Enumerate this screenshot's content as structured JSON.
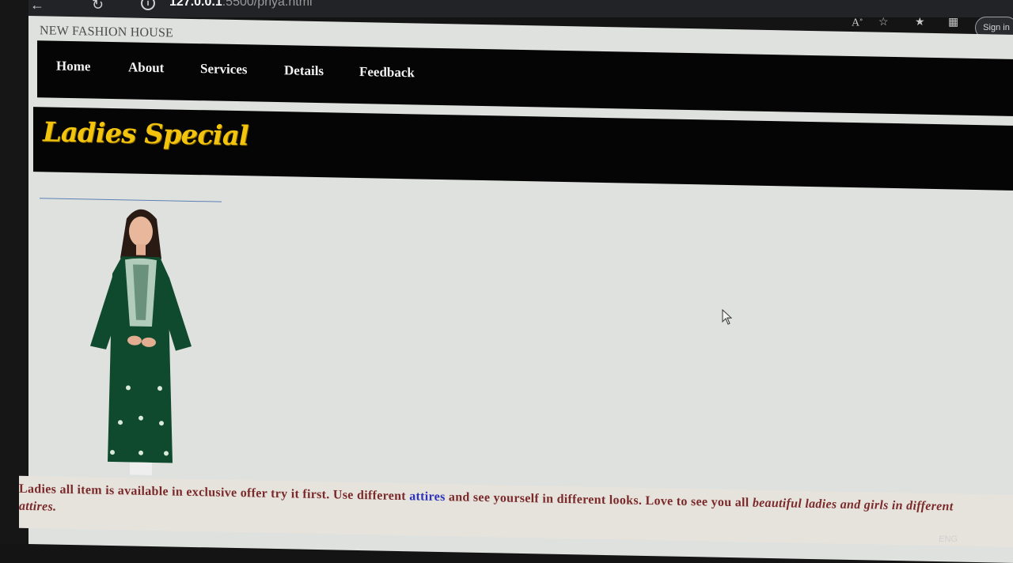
{
  "browser": {
    "url_host": "127.0.0.1",
    "url_rest": ":5500/priya.html",
    "sign_in_label": "Sign in"
  },
  "site": {
    "brand": "NEW FASHION HOUSE",
    "nav": [
      "Home",
      "About",
      "Services",
      "Details",
      "Feedback"
    ],
    "banner_title": "Ladies Special"
  },
  "caption": {
    "part1": "Ladies all item is available in exclusive offer try it first. Use different ",
    "link": "attires",
    "part2": " and see yourself in different looks. Love to see you all ",
    "italic": "beautiful ladies and girls in different",
    "line2": "attires."
  },
  "taskbar": {
    "lang": "ENG"
  },
  "colors": {
    "banner_title": "#f2c40e",
    "navbar_bg": "#050505",
    "page_bg": "#dfe1de",
    "caption_text": "#7a2a2a",
    "caption_link": "#2d33b8",
    "kurta_green": "#0f4a2e"
  },
  "icons": [
    "back-arrow-icon",
    "refresh-icon",
    "info-icon",
    "read-aloud-icon",
    "favorites-add-icon",
    "favorites-icon",
    "collections-icon",
    "cursor-icon"
  ]
}
